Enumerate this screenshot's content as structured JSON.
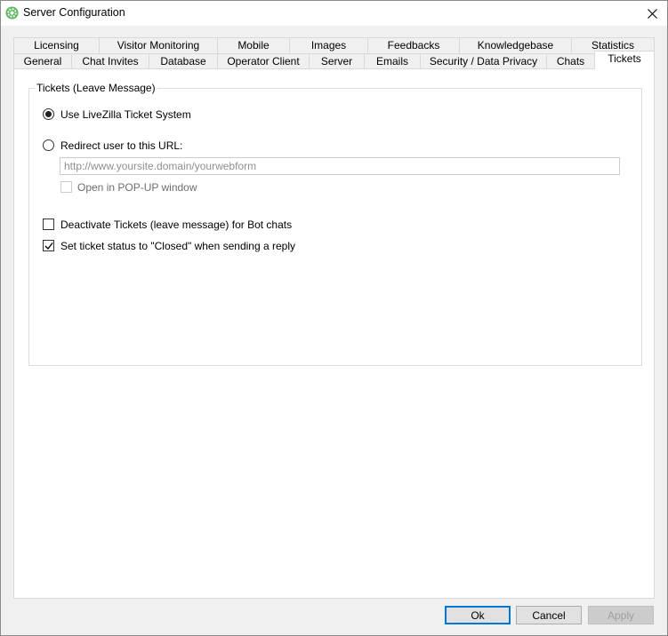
{
  "window": {
    "title": "Server Configuration"
  },
  "tabs": {
    "row1": [
      "Licensing",
      "Visitor Monitoring",
      "Mobile",
      "Images",
      "Feedbacks",
      "Knowledgebase",
      "Statistics"
    ],
    "row2": [
      "General",
      "Chat Invites",
      "Database",
      "Operator Client",
      "Server",
      "Emails",
      "Security / Data Privacy",
      "Chats",
      "Tickets"
    ],
    "active": "Tickets"
  },
  "tickets": {
    "group_title": "Tickets (Leave Message)",
    "use_livezilla_label": "Use LiveZilla Ticket System",
    "use_livezilla_selected": true,
    "redirect_label": "Redirect user to this URL:",
    "redirect_selected": false,
    "url_value": "",
    "url_placeholder": "http://www.yoursite.domain/yourwebform",
    "popup_label": "Open in POP-UP window",
    "popup_checked": false,
    "deactivate_bot_label": "Deactivate Tickets (leave message) for Bot chats",
    "deactivate_bot_checked": false,
    "set_closed_label": "Set ticket status to \"Closed\" when sending a reply",
    "set_closed_checked": true
  },
  "buttons": {
    "ok": "Ok",
    "cancel": "Cancel",
    "apply": "Apply"
  },
  "colors": {
    "app_icon": "#5cb85c",
    "accent": "#0078d7"
  },
  "icons": {
    "app": "livezilla-gear-icon",
    "close": "close-icon",
    "check": "checkmark-icon"
  }
}
